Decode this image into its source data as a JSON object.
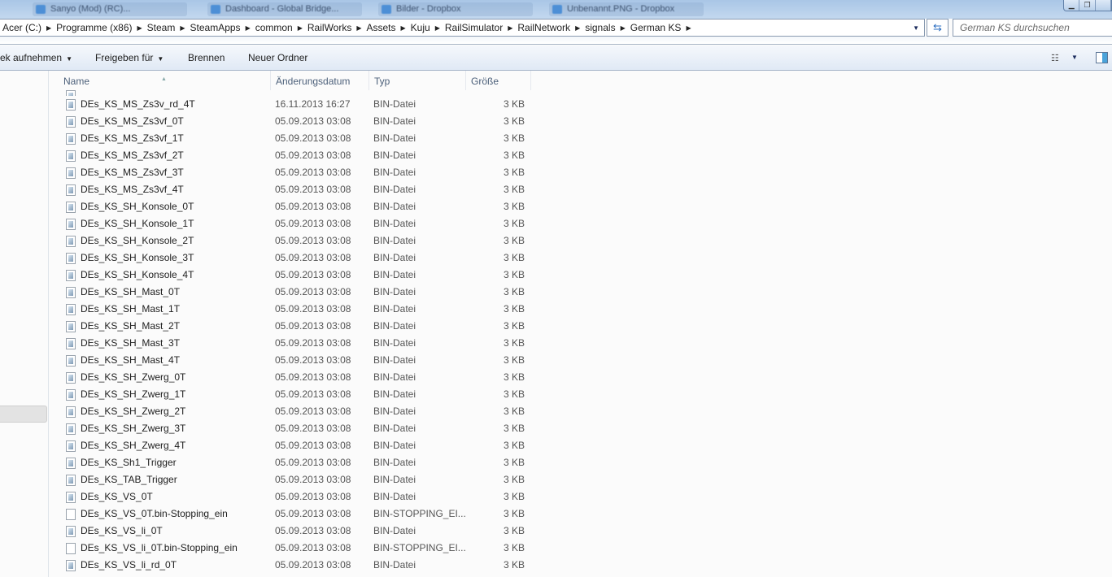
{
  "title_tabs": [
    "Sanyo (Mod) (RC)...",
    "Dashboard - Global Bridge...",
    "Bilder - Dropbox",
    "Unbenannt.PNG - Dropbox"
  ],
  "address": {
    "crumbs": [
      "Acer (C:)",
      "Programme (x86)",
      "Steam",
      "SteamApps",
      "common",
      "RailWorks",
      "Assets",
      "Kuju",
      "RailSimulator",
      "RailNetwork",
      "signals",
      "German KS"
    ]
  },
  "search": {
    "placeholder": "German KS durchsuchen"
  },
  "toolbar": {
    "include": "ek aufnehmen",
    "share": "Freigeben für",
    "burn": "Brennen",
    "new_folder": "Neuer Ordner"
  },
  "columns": {
    "name": "Name",
    "date": "Änderungsdatum",
    "type": "Typ",
    "size": "Größe"
  },
  "files": [
    {
      "name": "",
      "date": "",
      "type": "",
      "size": "",
      "icon": "bin"
    },
    {
      "name": "DEs_KS_MS_Zs3v_rd_4T",
      "date": "16.11.2013 16:27",
      "type": "BIN-Datei",
      "size": "3 KB",
      "icon": "bin"
    },
    {
      "name": "DEs_KS_MS_Zs3vf_0T",
      "date": "05.09.2013 03:08",
      "type": "BIN-Datei",
      "size": "3 KB",
      "icon": "bin"
    },
    {
      "name": "DEs_KS_MS_Zs3vf_1T",
      "date": "05.09.2013 03:08",
      "type": "BIN-Datei",
      "size": "3 KB",
      "icon": "bin"
    },
    {
      "name": "DEs_KS_MS_Zs3vf_2T",
      "date": "05.09.2013 03:08",
      "type": "BIN-Datei",
      "size": "3 KB",
      "icon": "bin"
    },
    {
      "name": "DEs_KS_MS_Zs3vf_3T",
      "date": "05.09.2013 03:08",
      "type": "BIN-Datei",
      "size": "3 KB",
      "icon": "bin"
    },
    {
      "name": "DEs_KS_MS_Zs3vf_4T",
      "date": "05.09.2013 03:08",
      "type": "BIN-Datei",
      "size": "3 KB",
      "icon": "bin"
    },
    {
      "name": "DEs_KS_SH_Konsole_0T",
      "date": "05.09.2013 03:08",
      "type": "BIN-Datei",
      "size": "3 KB",
      "icon": "bin"
    },
    {
      "name": "DEs_KS_SH_Konsole_1T",
      "date": "05.09.2013 03:08",
      "type": "BIN-Datei",
      "size": "3 KB",
      "icon": "bin"
    },
    {
      "name": "DEs_KS_SH_Konsole_2T",
      "date": "05.09.2013 03:08",
      "type": "BIN-Datei",
      "size": "3 KB",
      "icon": "bin"
    },
    {
      "name": "DEs_KS_SH_Konsole_3T",
      "date": "05.09.2013 03:08",
      "type": "BIN-Datei",
      "size": "3 KB",
      "icon": "bin"
    },
    {
      "name": "DEs_KS_SH_Konsole_4T",
      "date": "05.09.2013 03:08",
      "type": "BIN-Datei",
      "size": "3 KB",
      "icon": "bin"
    },
    {
      "name": "DEs_KS_SH_Mast_0T",
      "date": "05.09.2013 03:08",
      "type": "BIN-Datei",
      "size": "3 KB",
      "icon": "bin"
    },
    {
      "name": "DEs_KS_SH_Mast_1T",
      "date": "05.09.2013 03:08",
      "type": "BIN-Datei",
      "size": "3 KB",
      "icon": "bin"
    },
    {
      "name": "DEs_KS_SH_Mast_2T",
      "date": "05.09.2013 03:08",
      "type": "BIN-Datei",
      "size": "3 KB",
      "icon": "bin"
    },
    {
      "name": "DEs_KS_SH_Mast_3T",
      "date": "05.09.2013 03:08",
      "type": "BIN-Datei",
      "size": "3 KB",
      "icon": "bin"
    },
    {
      "name": "DEs_KS_SH_Mast_4T",
      "date": "05.09.2013 03:08",
      "type": "BIN-Datei",
      "size": "3 KB",
      "icon": "bin"
    },
    {
      "name": "DEs_KS_SH_Zwerg_0T",
      "date": "05.09.2013 03:08",
      "type": "BIN-Datei",
      "size": "3 KB",
      "icon": "bin"
    },
    {
      "name": "DEs_KS_SH_Zwerg_1T",
      "date": "05.09.2013 03:08",
      "type": "BIN-Datei",
      "size": "3 KB",
      "icon": "bin"
    },
    {
      "name": "DEs_KS_SH_Zwerg_2T",
      "date": "05.09.2013 03:08",
      "type": "BIN-Datei",
      "size": "3 KB",
      "icon": "bin"
    },
    {
      "name": "DEs_KS_SH_Zwerg_3T",
      "date": "05.09.2013 03:08",
      "type": "BIN-Datei",
      "size": "3 KB",
      "icon": "bin"
    },
    {
      "name": "DEs_KS_SH_Zwerg_4T",
      "date": "05.09.2013 03:08",
      "type": "BIN-Datei",
      "size": "3 KB",
      "icon": "bin"
    },
    {
      "name": "DEs_KS_Sh1_Trigger",
      "date": "05.09.2013 03:08",
      "type": "BIN-Datei",
      "size": "3 KB",
      "icon": "bin"
    },
    {
      "name": "DEs_KS_TAB_Trigger",
      "date": "05.09.2013 03:08",
      "type": "BIN-Datei",
      "size": "3 KB",
      "icon": "bin"
    },
    {
      "name": "DEs_KS_VS_0T",
      "date": "05.09.2013 03:08",
      "type": "BIN-Datei",
      "size": "3 KB",
      "icon": "bin"
    },
    {
      "name": "DEs_KS_VS_0T.bin-Stopping_ein",
      "date": "05.09.2013 03:08",
      "type": "BIN-STOPPING_EI...",
      "size": "3 KB",
      "icon": "blank"
    },
    {
      "name": "DEs_KS_VS_li_0T",
      "date": "05.09.2013 03:08",
      "type": "BIN-Datei",
      "size": "3 KB",
      "icon": "bin"
    },
    {
      "name": "DEs_KS_VS_li_0T.bin-Stopping_ein",
      "date": "05.09.2013 03:08",
      "type": "BIN-STOPPING_EI...",
      "size": "3 KB",
      "icon": "blank"
    },
    {
      "name": "DEs_KS_VS_li_rd_0T",
      "date": "05.09.2013 03:08",
      "type": "BIN-Datei",
      "size": "3 KB",
      "icon": "bin"
    }
  ]
}
